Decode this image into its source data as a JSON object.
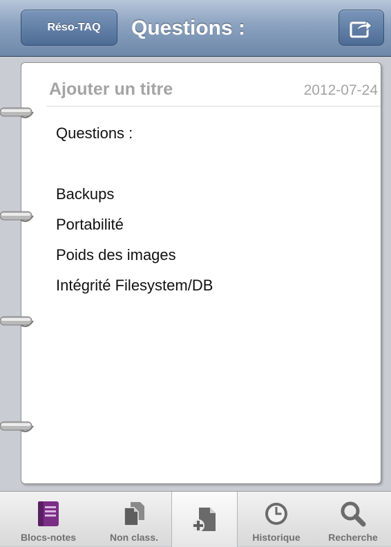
{
  "navbar": {
    "back_label": "Réso-TAQ",
    "title": "Questions :",
    "share_icon": "share-icon"
  },
  "note": {
    "title_placeholder": "Ajouter un titre",
    "date": "2012-07-24",
    "lines": [
      "Questions :",
      "",
      "Backups",
      "Portabilité",
      "Poids des images",
      "Intégrité Filesystem/DB"
    ]
  },
  "tabbar": {
    "tabs": [
      {
        "label": "Blocs-notes",
        "icon": "notebook-icon"
      },
      {
        "label": "Non class.",
        "icon": "unfiled-pages-icon"
      },
      {
        "label": "",
        "icon": "new-page-icon"
      },
      {
        "label": "Historique",
        "icon": "clock-icon"
      },
      {
        "label": "Recherche",
        "icon": "search-icon"
      }
    ]
  },
  "colors": {
    "navbar": "#7f97b8",
    "notebook": "#7b2e86",
    "tab_icon": "#6b6b6b",
    "title_placeholder": "#a4a4a4"
  }
}
